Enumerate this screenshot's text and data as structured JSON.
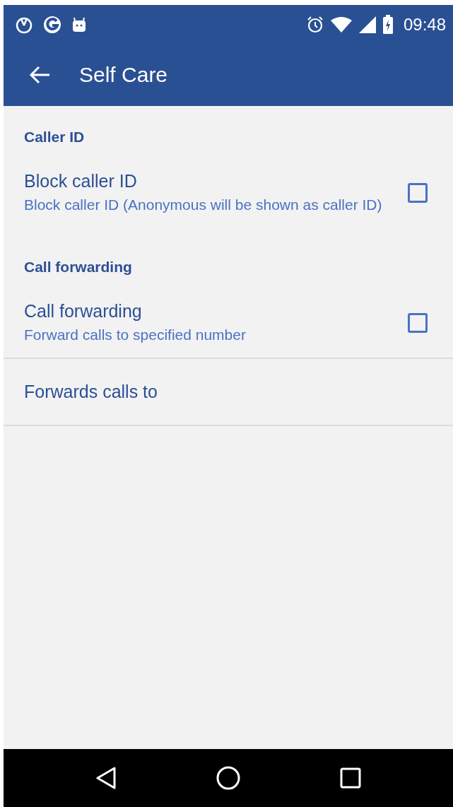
{
  "status_bar": {
    "time": "09:48"
  },
  "toolbar": {
    "title": "Self Care"
  },
  "sections": [
    {
      "header": "Caller ID",
      "items": [
        {
          "kind": "checkbox",
          "title": "Block caller ID",
          "summary": "Block caller ID (Anonymous will be shown as caller ID)",
          "checked": false
        }
      ]
    },
    {
      "header": "Call forwarding",
      "items": [
        {
          "kind": "checkbox",
          "title": "Call forwarding",
          "summary": "Forward calls to specified number",
          "checked": false
        },
        {
          "kind": "plain",
          "title": "Forwards calls to"
        }
      ]
    }
  ]
}
